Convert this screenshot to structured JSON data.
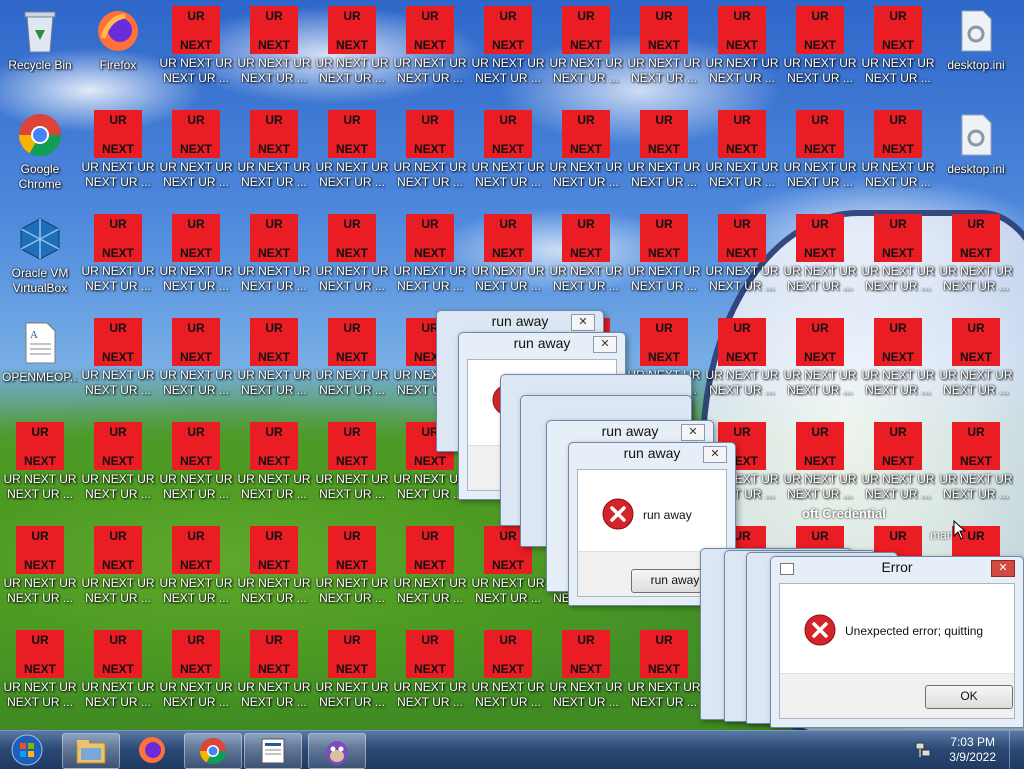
{
  "desktop": {
    "system_icons": [
      {
        "label": "Recycle Bin",
        "icon": "recycle-bin-icon"
      },
      {
        "label": "Firefox",
        "icon": "firefox-icon"
      },
      {
        "label": "Google Chrome",
        "icon": "chrome-icon"
      },
      {
        "label": "Oracle VM VirtualBox",
        "icon": "virtualbox-icon"
      },
      {
        "label": "OPENMEOP...",
        "icon": "document-icon"
      },
      {
        "label": "desktop.ini",
        "icon": "ini-file-icon"
      },
      {
        "label": "desktop.ini",
        "icon": "ini-file-icon"
      }
    ],
    "ur_icon": {
      "top_text": "UR",
      "bottom_text": "NEXT",
      "label": "UR NEXT UR NEXT UR ...",
      "color": "#ea1c24"
    },
    "background_text": [
      "oft Credential",
      "mani"
    ]
  },
  "dialogs": {
    "runaway": {
      "title": "run away",
      "message": "run away",
      "button": "run away"
    },
    "error": {
      "title": "Error",
      "message": "Unexpected error; quitting",
      "button": "OK"
    }
  },
  "taskbar": {
    "time": "7:03 PM",
    "date": "3/9/2022",
    "items": [
      "start-button",
      "file-explorer",
      "firefox",
      "chrome",
      "notepad-document",
      "bonzi-buddy"
    ]
  }
}
